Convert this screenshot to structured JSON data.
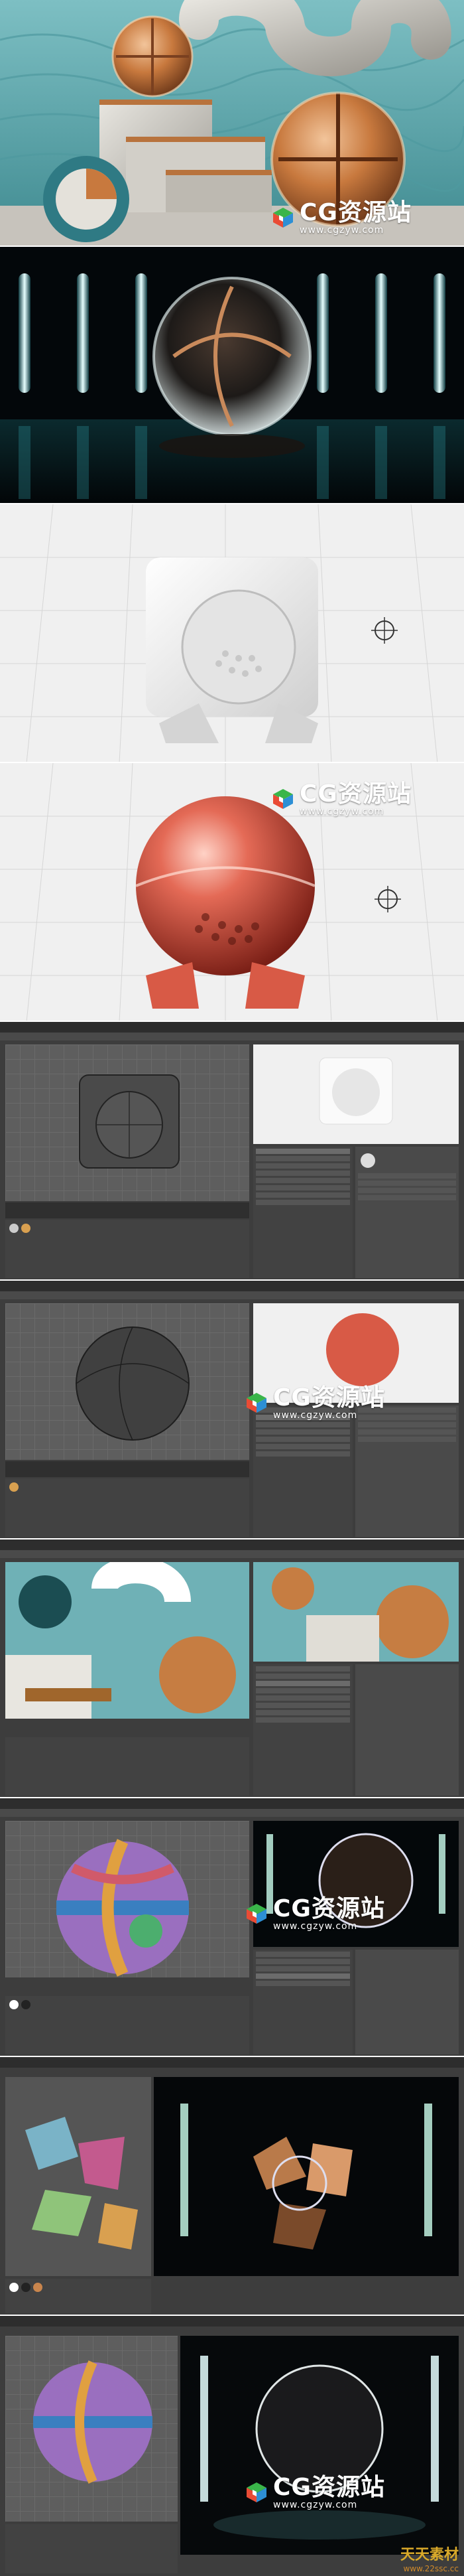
{
  "watermark": {
    "brand": "CG资源站",
    "url": "www.cgzyw.com"
  },
  "footer": {
    "brand": "天天素材",
    "url": "www.22ssc.cc"
  },
  "colors": {
    "teal": "#5aa6ad",
    "copper": "#c9854d",
    "red": "#d3493a",
    "ui_bg": "#3d3d3d"
  }
}
